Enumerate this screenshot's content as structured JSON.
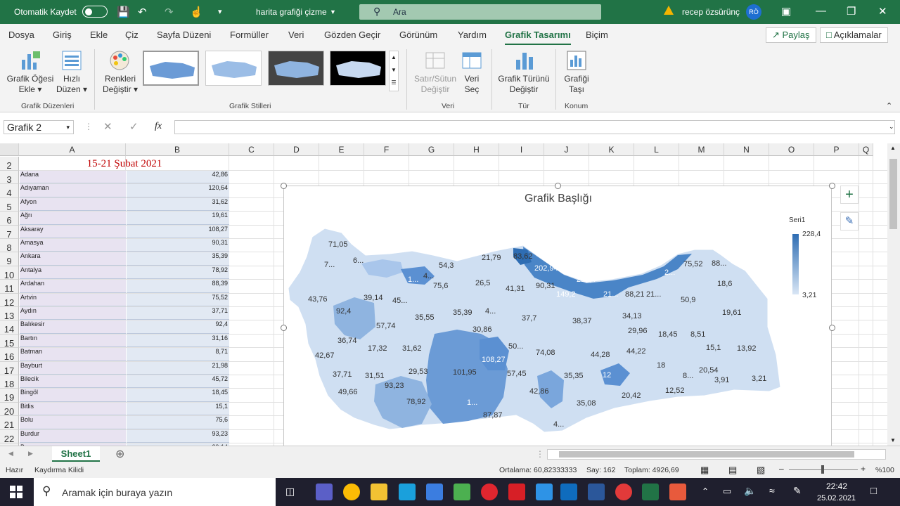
{
  "titlebar": {
    "autosave_label": "Otomatik Kaydet",
    "doc_title": "harita grafiği çizme",
    "search_placeholder": "Ara",
    "user_name": "recep özsürünç",
    "user_initials": "RÖ",
    "accent": "#217346"
  },
  "tabs": [
    "Dosya",
    "Giriş",
    "Ekle",
    "Çiz",
    "Sayfa Düzeni",
    "Formüller",
    "Veri",
    "Gözden Geçir",
    "Görünüm",
    "Yardım",
    "Grafik Tasarımı",
    "Biçim"
  ],
  "active_tab": "Grafik Tasarımı",
  "share_label": "Paylaş",
  "comments_label": "Açıklamalar",
  "ribbon": {
    "add_element": [
      "Grafik Öğesi",
      "Ekle"
    ],
    "quick_layout": [
      "Hızlı",
      "Düzen"
    ],
    "change_colors": [
      "Renkleri",
      "Değiştir"
    ],
    "switch_row_col": [
      "Satır/Sütun",
      "Değiştir"
    ],
    "select_data": [
      "Veri",
      "Seç"
    ],
    "change_type": [
      "Grafik Türünü",
      "Değiştir"
    ],
    "move_chart": [
      "Grafiği",
      "Taşı"
    ],
    "groups": {
      "layouts": "Grafik Düzenleri",
      "styles": "Grafik Stilleri",
      "data": "Veri",
      "type": "Tür",
      "location": "Konum"
    }
  },
  "formula": {
    "name_box": "Grafik 2",
    "fx": "fx",
    "value": ""
  },
  "columns": [
    "A",
    "B",
    "C",
    "D",
    "E",
    "F",
    "G",
    "H",
    "I",
    "J",
    "K",
    "L",
    "M",
    "N",
    "O",
    "P",
    "Q"
  ],
  "row_numbers": [
    "2",
    "3",
    "4",
    "5",
    "6",
    "7",
    "8",
    "9",
    "10",
    "11",
    "12",
    "13",
    "14",
    "15",
    "16",
    "17",
    "18",
    "19",
    "20",
    "21",
    "22",
    "23"
  ],
  "header_cell": "15-21 Şubat 2021",
  "rows": [
    {
      "name": "Adana",
      "value": "42,86"
    },
    {
      "name": "Adıyaman",
      "value": "120,64"
    },
    {
      "name": "Afyon",
      "value": "31,62"
    },
    {
      "name": "Ağrı",
      "value": "19,61"
    },
    {
      "name": "Aksaray",
      "value": "108,27"
    },
    {
      "name": "Amasya",
      "value": "90,31"
    },
    {
      "name": "Ankara",
      "value": "35,39"
    },
    {
      "name": "Antalya",
      "value": "78,92"
    },
    {
      "name": "Ardahan",
      "value": "88,39"
    },
    {
      "name": "Artvin",
      "value": "75,52"
    },
    {
      "name": "Aydın",
      "value": "37,71"
    },
    {
      "name": "Balıkesir",
      "value": "92,4"
    },
    {
      "name": "Bartın",
      "value": "31,16"
    },
    {
      "name": "Batman",
      "value": "8,71"
    },
    {
      "name": "Bayburt",
      "value": "21,98"
    },
    {
      "name": "Bilecik",
      "value": "45,72"
    },
    {
      "name": "Bingöl",
      "value": "18,45"
    },
    {
      "name": "Bitlis",
      "value": "15,1"
    },
    {
      "name": "Bolu",
      "value": "75,6"
    },
    {
      "name": "Burdur",
      "value": "93,23"
    },
    {
      "name": "Bursa",
      "value": "39,14"
    }
  ],
  "chart": {
    "title": "Grafik Başlığı",
    "legend_title": "Seri1",
    "legend_max": "228,4",
    "legend_min": "3,21",
    "color_dark": "#2e6db3",
    "color_light": "#d9e6f5",
    "labels": [
      {
        "t": "71,05",
        "w": false
      },
      {
        "t": "7...",
        "w": false
      },
      {
        "t": "6...",
        "w": false
      },
      {
        "t": "54,3",
        "w": false
      },
      {
        "t": "21,79",
        "w": false
      },
      {
        "t": "83,62",
        "w": false
      },
      {
        "t": "202,94",
        "w": true
      },
      {
        "t": "228,4",
        "w": true
      },
      {
        "t": "2...",
        "w": true
      },
      {
        "t": "75,52",
        "w": false
      },
      {
        "t": "88...",
        "w": false
      },
      {
        "t": "1...",
        "w": true
      },
      {
        "t": "4...",
        "w": false
      },
      {
        "t": "75,6",
        "w": false
      },
      {
        "t": "26,5",
        "w": false
      },
      {
        "t": "41,31",
        "w": false
      },
      {
        "t": "90,31",
        "w": false
      },
      {
        "t": "149,2",
        "w": true
      },
      {
        "t": "21...",
        "w": true
      },
      {
        "t": "88,21",
        "w": false
      },
      {
        "t": "21...",
        "w": false
      },
      {
        "t": "18,6",
        "w": false
      },
      {
        "t": "43,76",
        "w": false
      },
      {
        "t": "39,14",
        "w": false
      },
      {
        "t": "45...",
        "w": false
      },
      {
        "t": "50,9",
        "w": false
      },
      {
        "t": "92,4",
        "w": false
      },
      {
        "t": "35,55",
        "w": false
      },
      {
        "t": "35,39",
        "w": false
      },
      {
        "t": "4...",
        "w": false
      },
      {
        "t": "37,7",
        "w": false
      },
      {
        "t": "38,37",
        "w": false
      },
      {
        "t": "34,13",
        "w": false
      },
      {
        "t": "19,61",
        "w": false
      },
      {
        "t": "57,74",
        "w": false
      },
      {
        "t": "30,86",
        "w": false
      },
      {
        "t": "29,96",
        "w": false
      },
      {
        "t": "18,45",
        "w": false
      },
      {
        "t": "8,51",
        "w": false
      },
      {
        "t": "36,74",
        "w": false
      },
      {
        "t": "17,32",
        "w": false
      },
      {
        "t": "31,62",
        "w": false
      },
      {
        "t": "50...",
        "w": false
      },
      {
        "t": "74,08",
        "w": false
      },
      {
        "t": "15,1",
        "w": false
      },
      {
        "t": "13,92",
        "w": false
      },
      {
        "t": "42,67",
        "w": false
      },
      {
        "t": "108,27",
        "w": true
      },
      {
        "t": "44,28",
        "w": false
      },
      {
        "t": "44,22",
        "w": false
      },
      {
        "t": "101,95",
        "w": false
      },
      {
        "t": "18",
        "w": false
      },
      {
        "t": "37,71",
        "w": false
      },
      {
        "t": "31,51",
        "w": false
      },
      {
        "t": "29,53",
        "w": false
      },
      {
        "t": "57,45",
        "w": false
      },
      {
        "t": "35,35",
        "w": false
      },
      {
        "t": "12",
        "w": true
      },
      {
        "t": "20,54",
        "w": false
      },
      {
        "t": "93,23",
        "w": false
      },
      {
        "t": "8...",
        "w": false
      },
      {
        "t": "3,91",
        "w": false
      },
      {
        "t": "3,21",
        "w": false
      },
      {
        "t": "49,66",
        "w": false
      },
      {
        "t": "42,86",
        "w": false
      },
      {
        "t": "12,52",
        "w": false
      },
      {
        "t": "78,92",
        "w": false
      },
      {
        "t": "1...",
        "w": true
      },
      {
        "t": "35,08",
        "w": false
      },
      {
        "t": "20,42",
        "w": false
      },
      {
        "t": "87,87",
        "w": false
      },
      {
        "t": "4...",
        "w": false
      }
    ]
  },
  "sheet_tab": "Sheet1",
  "status": {
    "ready": "Hazır",
    "scroll_lock": "Kaydırma Kilidi",
    "average": "Ortalama: 60,82333333",
    "count": "Say: 162",
    "sum": "Toplam: 4926,69",
    "zoom": "%100"
  },
  "taskbar": {
    "search_placeholder": "Aramak için buraya yazın",
    "time": "22:42",
    "date": "25.02.2021"
  }
}
